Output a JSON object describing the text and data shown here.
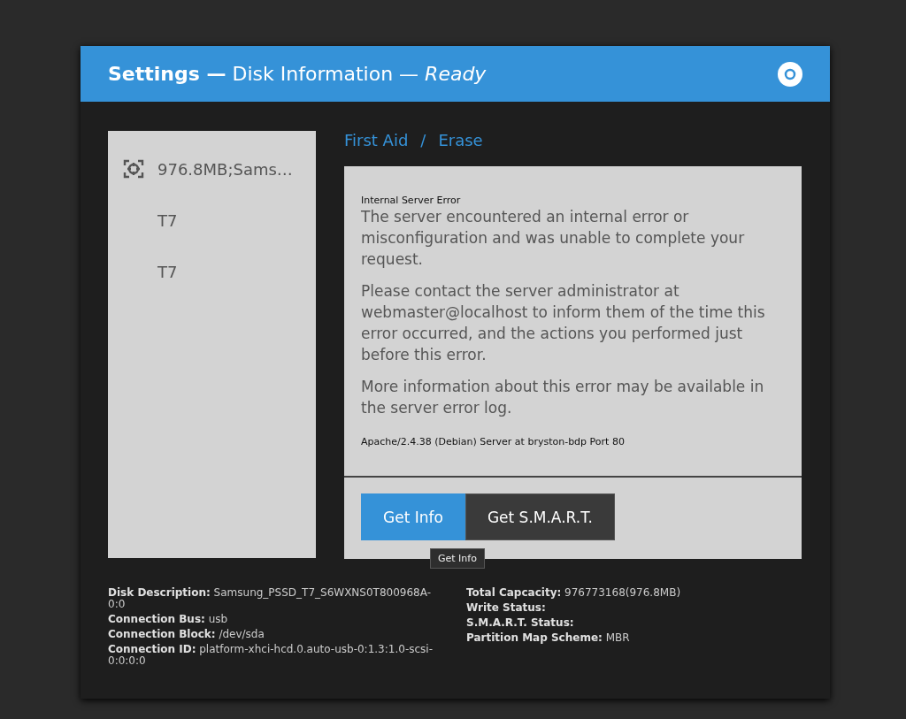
{
  "window": {
    "title": "**Settings —** Disk Information — *Ready*"
  },
  "breadcrumb": [
    {
      "label": "First Aid"
    },
    {
      "separator": "/"
    },
    {
      "label": "Erase"
    }
  ],
  "sidebar": {
    "items": [
      {
        "label": "976.8MB;Sams…",
        "kind": "disk"
      },
      {
        "label": "T7",
        "kind": "volume"
      },
      {
        "label": "T7",
        "kind": "volume"
      }
    ]
  },
  "error_page": {
    "heading": "Internal Server Error",
    "paragraphs": [
      "The server encountered an internal error or misconfiguration and was unable to complete your request.",
      "Please contact the server administrator at webmaster@localhost to inform them of the time this error occurred, and the actions you performed just before this error.",
      "More information about this error may be available in the server error log."
    ],
    "address": "Apache/2.4.38 (Debian) Server at bryston-bdp Port 80"
  },
  "buttons": [
    {
      "label": "Get Info",
      "selected": true
    },
    {
      "label": "Get S.M.A.R.T.",
      "selected": false
    }
  ],
  "tooltip": "Get Info",
  "details": {
    "left": [
      {
        "label": "Disk Description:",
        "value": "Samsung_PSSD_T7_S6WXNS0T800968A-0:0"
      },
      {
        "label": "Connection Bus:",
        "value": "usb"
      },
      {
        "label": "Connection Block:",
        "value": "/dev/sda"
      },
      {
        "label": "Connection ID:",
        "value": "platform-xhci-hcd.0.auto-usb-0:1.3:1.0-scsi-0:0:0:0"
      }
    ],
    "right": [
      {
        "label": "Total Capcacity:",
        "value": "976773168(976.8MB)"
      },
      {
        "label": "Write Status:"
      },
      {
        "label": "S.M.A.R.T. Status:"
      },
      {
        "label": "Partition Map Scheme:",
        "value": "MBR"
      }
    ]
  }
}
